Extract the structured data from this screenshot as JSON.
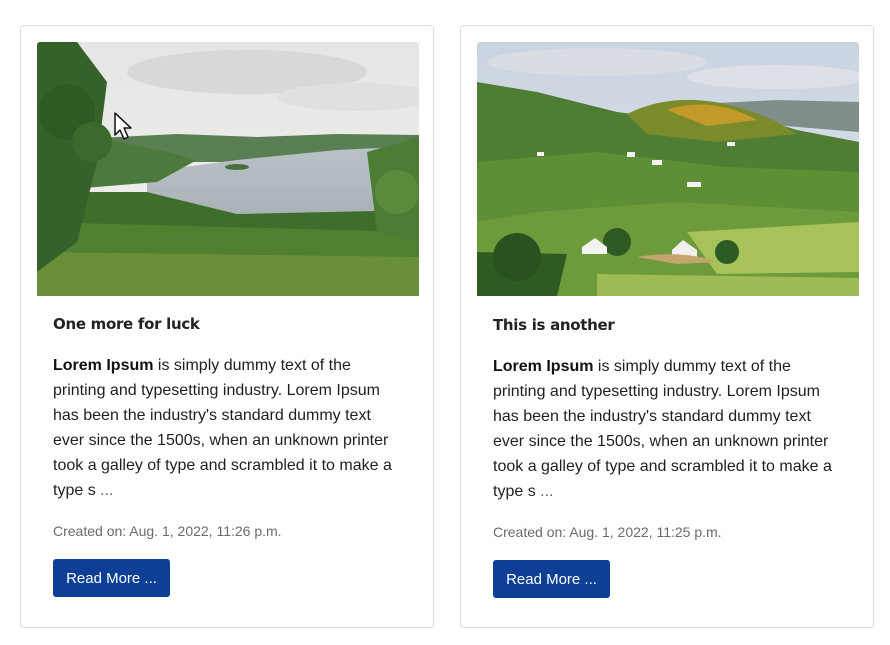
{
  "cards": [
    {
      "title": "One more for luck",
      "body_bold": "Lorem Ipsum",
      "body_rest": " is simply dummy text of the printing and typesetting industry. Lorem Ipsum has been the industry's standard dummy text ever since the 1500s, when an unknown printer took a galley of type and scrambled it to make a type s ",
      "ellipsis": "...",
      "date": "Created on: Aug. 1, 2022, 11:26 p.m.",
      "button_label": "Read More ..."
    },
    {
      "title": "This is another",
      "body_bold": "Lorem Ipsum",
      "body_rest": " is simply dummy text of the printing and typesetting industry. Lorem Ipsum has been the industry's standard dummy text ever since the 1500s, when an unknown printer took a galley of type and scrambled it to make a type s ",
      "ellipsis": "...",
      "date": "Created on: Aug. 1, 2022, 11:25 p.m.",
      "button_label": "Read More ..."
    }
  ],
  "colors": {
    "button_bg": "#0d3f96",
    "card_border": "#dcdcdc",
    "date_text": "#6b6b6b"
  },
  "icons": [
    "mouse-cursor-icon"
  ]
}
